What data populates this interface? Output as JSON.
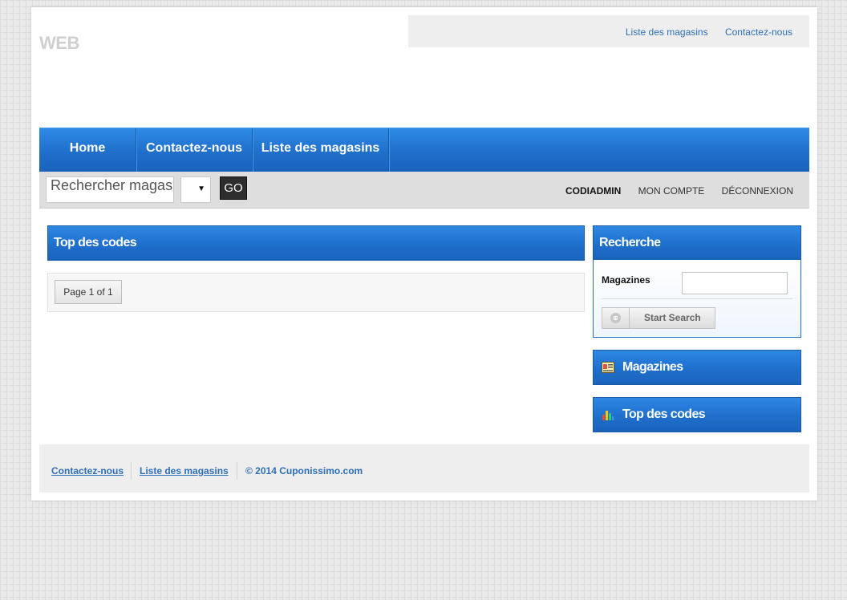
{
  "header": {
    "logo": "WEB",
    "top_links": [
      "Liste des magasins",
      "Contactez-nous"
    ]
  },
  "nav": {
    "items": [
      "Home",
      "Contactez-nous",
      "Liste des magasins"
    ]
  },
  "search": {
    "input_value": "Rechercher magas",
    "go_label": "GO"
  },
  "user": {
    "name": "CODIADMIN",
    "account": "MON COMPTE",
    "logout": "DÉCONNEXION"
  },
  "main": {
    "title": "Top des codes",
    "pager": "Page 1 of 1"
  },
  "sidebar": {
    "search_title": "Recherche",
    "magazines_label": "Magazines",
    "magazines_value": "",
    "start_search": "Start Search",
    "magazines_title": "Magazines",
    "top_codes_title": "Top des codes"
  },
  "footer": {
    "links": [
      "Contactez-nous",
      "Liste des magasins"
    ],
    "copyright": "© 2014 Cuponissimo.com"
  },
  "colors": {
    "nav_blue": "#1f6fcc",
    "link_blue": "#2f6fb8",
    "go_button": "#2d2d2d"
  }
}
